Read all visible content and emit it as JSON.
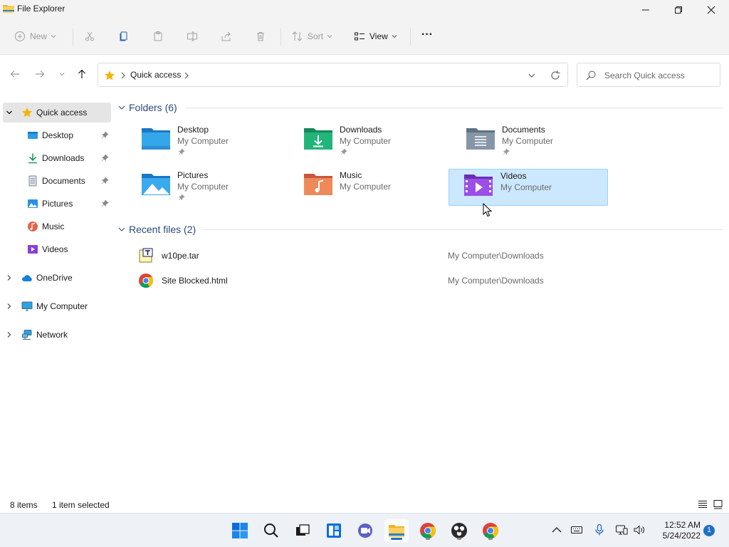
{
  "window": {
    "title": "File Explorer"
  },
  "toolbar": {
    "new_label": "New",
    "sort_label": "Sort",
    "view_label": "View",
    "more_label": "···"
  },
  "address": {
    "crumb": "Quick access",
    "search_placeholder": "Search Quick access"
  },
  "sidebar": {
    "items": [
      {
        "label": "Quick access",
        "icon": "star-icon"
      },
      {
        "label": "Desktop",
        "icon": "desktop-folder-icon"
      },
      {
        "label": "Downloads",
        "icon": "download-arrow-icon"
      },
      {
        "label": "Documents",
        "icon": "documents-icon"
      },
      {
        "label": "Pictures",
        "icon": "pictures-icon"
      },
      {
        "label": "Music",
        "icon": "music-icon"
      },
      {
        "label": "Videos",
        "icon": "videos-icon"
      },
      {
        "label": "OneDrive",
        "icon": "onedrive-cloud-icon"
      },
      {
        "label": "My Computer",
        "icon": "monitor-icon"
      },
      {
        "label": "Network",
        "icon": "network-icon"
      }
    ]
  },
  "content": {
    "folders_header": "Folders (6)",
    "recent_header": "Recent files (2)",
    "folders": [
      {
        "name": "Desktop",
        "location": "My Computer"
      },
      {
        "name": "Downloads",
        "location": "My Computer"
      },
      {
        "name": "Documents",
        "location": "My Computer"
      },
      {
        "name": "Pictures",
        "location": "My Computer"
      },
      {
        "name": "Music",
        "location": "My Computer"
      },
      {
        "name": "Videos",
        "location": "My Computer"
      }
    ],
    "recent": [
      {
        "name": "w10pe.tar",
        "path": "My Computer\\Downloads"
      },
      {
        "name": "Site Blocked.html",
        "path": "My Computer\\Downloads"
      }
    ]
  },
  "status": {
    "items_count": "8 items",
    "selection": "1 item selected"
  },
  "taskbar": {
    "time": "12:52 AM",
    "date": "5/24/2022",
    "notification_count": "1"
  },
  "colors": {
    "accent": "#0067c0",
    "selection_bg": "#cce8ff",
    "selection_border": "#99d1ff",
    "group_header": "#2b4a7a"
  }
}
